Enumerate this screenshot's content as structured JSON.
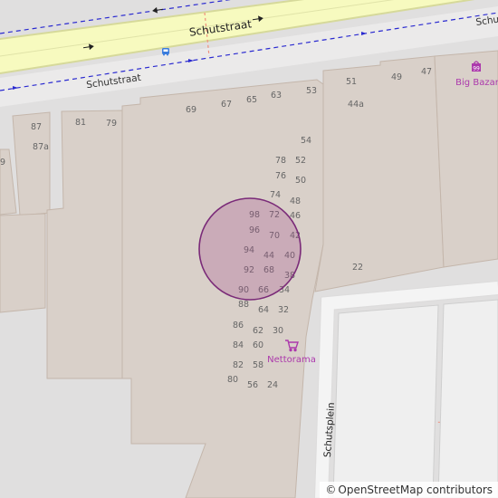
{
  "map": {
    "streets": {
      "main_road": "Schutstraat",
      "service_road": "Schutstraat",
      "edge_road": "Schu",
      "square": "Schutsplein"
    },
    "shops": {
      "top_right": "Big Bazar",
      "center": "Nettorama"
    },
    "house_numbers": {
      "n87": "87",
      "n87a": "87a",
      "n9": "9",
      "n81": "81",
      "n79": "79",
      "n69": "69",
      "n67": "67",
      "n65": "65",
      "n63": "63",
      "n53": "53",
      "n51": "51",
      "n49": "49",
      "n47": "47",
      "n44a": "44a",
      "n54": "54",
      "n78": "78",
      "n52": "52",
      "n76": "76",
      "n50": "50",
      "n74": "74",
      "n48": "48",
      "n98": "98",
      "n72": "72",
      "n46": "46",
      "n96": "96",
      "n70": "70",
      "n42": "42",
      "n94": "94",
      "n44": "44",
      "n40": "40",
      "n92": "92",
      "n68": "68",
      "n38": "38",
      "n90": "90",
      "n66": "66",
      "n34": "34",
      "n88": "88",
      "n64": "64",
      "n32": "32",
      "n86": "86",
      "n62": "62",
      "n30": "30",
      "n84": "84",
      "n60": "60",
      "n82": "82",
      "n58": "58",
      "n80": "80",
      "n56": "56",
      "n24": "24",
      "n22": "22"
    },
    "attribution": {
      "symbol": "©",
      "text": "OpenStreetMap contributors"
    },
    "colors": {
      "background": "#e5e3df",
      "building": "#d9d0c9",
      "building_outline": "#c4b6ab",
      "main_road_fill": "#f7fabf",
      "main_road_casing": "#d6d99a",
      "bus_route": "#2a2ad0",
      "shop_label": "#ac39ac",
      "marker_fill": "#a64d8c",
      "marker_stroke": "#7a2a78"
    },
    "icons": {
      "bus_stop": "bus-stop-icon",
      "shop": "shopping-cart-icon",
      "mall": "mall-icon",
      "arrow": "oneway-arrow-icon"
    }
  }
}
